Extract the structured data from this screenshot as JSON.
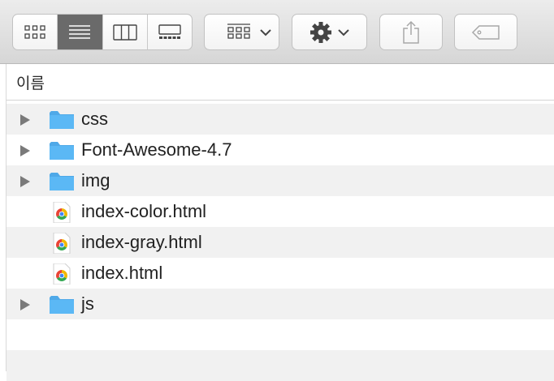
{
  "toolbar": {
    "view_modes": [
      "icon-view",
      "list-view",
      "column-view",
      "gallery-view"
    ],
    "active_view": "list-view",
    "buttons": [
      "group-by-menu",
      "action-menu",
      "share",
      "tags"
    ]
  },
  "column_header": {
    "name_label": "이름"
  },
  "rows": [
    {
      "name": "css",
      "kind": "folder",
      "expandable": true
    },
    {
      "name": "Font-Awesome-4.7",
      "kind": "folder",
      "expandable": true
    },
    {
      "name": "img",
      "kind": "folder",
      "expandable": true
    },
    {
      "name": "index-color.html",
      "kind": "chrome-html",
      "expandable": false
    },
    {
      "name": "index-gray.html",
      "kind": "chrome-html",
      "expandable": false
    },
    {
      "name": "index.html",
      "kind": "chrome-html",
      "expandable": false
    },
    {
      "name": "js",
      "kind": "folder",
      "expandable": true
    }
  ],
  "colors": {
    "folder": "#5bb8f5",
    "folder_tab": "#4fa9e8",
    "active_segment": "#6a6a6a",
    "row_alt": "#f1f1f1"
  }
}
